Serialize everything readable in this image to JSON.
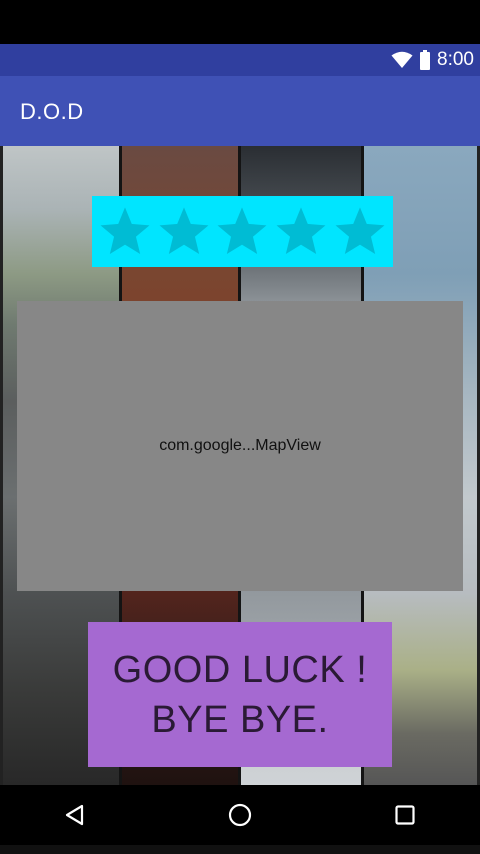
{
  "status_bar": {
    "time": "8:00",
    "wifi_icon": "wifi-icon",
    "battery_icon": "battery-icon"
  },
  "app_bar": {
    "title": "D.O.D"
  },
  "rating": {
    "stars": 5,
    "max": 5,
    "star_color": "#00bcd4",
    "background": "#00e5ff"
  },
  "map": {
    "placeholder_text": "com.google...MapView"
  },
  "farewell": {
    "line1": "GOOD LUCK !",
    "line2": "BYE BYE."
  },
  "nav_bar": {
    "back_icon": "back-icon",
    "home_icon": "home-icon",
    "recents_icon": "recents-icon"
  },
  "colors": {
    "primary": "#3f51b5",
    "primary_dark": "#303f9f",
    "farewell_bg": "#a569d1",
    "map_bg": "#878787"
  }
}
